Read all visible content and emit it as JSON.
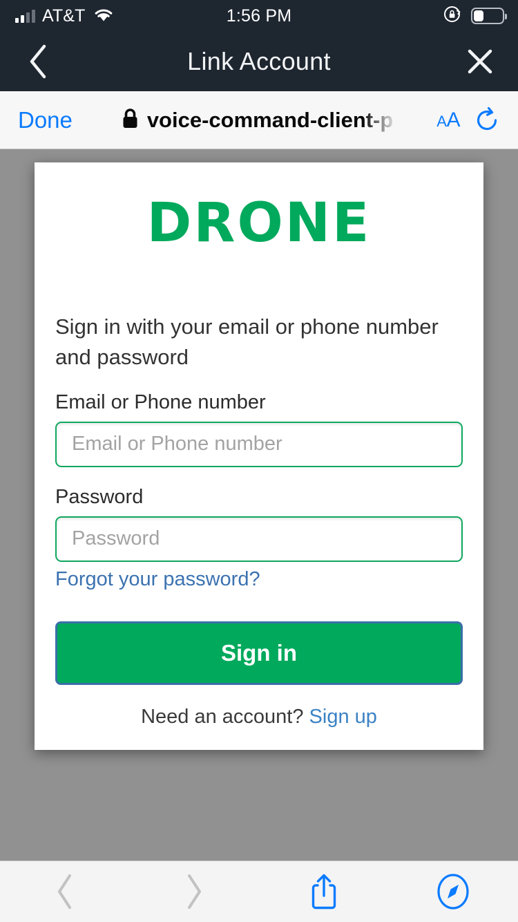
{
  "status_bar": {
    "carrier": "AT&T",
    "time": "1:56 PM",
    "signal_icon": "cellular-signal-icon",
    "wifi_icon": "wifi-icon",
    "rotation_lock_icon": "rotation-lock-icon",
    "battery_icon": "battery-icon",
    "battery_level_percent": 36
  },
  "nav_bar": {
    "title": "Link Account",
    "back_icon": "chevron-left-icon",
    "close_icon": "close-x-icon",
    "background_color": "#1E2630"
  },
  "safari_bar": {
    "done_label": "Done",
    "lock_icon": "lock-icon",
    "url": "voice-command-client-p",
    "text_size_label_small": "A",
    "text_size_label_large": "A",
    "reload_icon": "reload-icon"
  },
  "page": {
    "background_color": "#919191",
    "card": {
      "logo_text": "DRONE",
      "logo_color": "#00A95C",
      "intro_text": "Sign in with your email or phone number and password",
      "fields": [
        {
          "label": "Email or Phone number",
          "placeholder": "Email or Phone number",
          "value": "",
          "type": "text"
        },
        {
          "label": "Password",
          "placeholder": "Password",
          "value": "",
          "type": "password"
        }
      ],
      "forgot_password_label": "Forgot your password?",
      "submit_label": "Sign in",
      "submit_color": "#00A95C",
      "footer_prompt": "Need an account?",
      "footer_link_label": "Sign up",
      "link_color": "#3B82C4"
    }
  },
  "toolbar": {
    "back_icon": "chevron-left-icon",
    "forward_icon": "chevron-right-icon",
    "share_icon": "share-icon",
    "bookmarks_icon": "safari-compass-icon",
    "back_enabled": false,
    "forward_enabled": false
  }
}
